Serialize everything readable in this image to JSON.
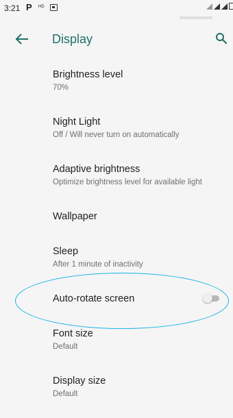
{
  "status_bar": {
    "time": "3:21",
    "icons": [
      "parking-notification-icon",
      "hd-icon",
      "sd-card-icon",
      "signal-icon",
      "signal-icon",
      "battery-icon"
    ],
    "p_glyph": "P",
    "hd_glyph": "HD"
  },
  "app_bar": {
    "title": "Display",
    "back_icon": "back-arrow-icon",
    "search_icon": "search-icon"
  },
  "settings": [
    {
      "label": "Brightness level",
      "summary": "70%"
    },
    {
      "label": "Night Light",
      "summary": "Off / Will never turn on automatically"
    },
    {
      "label": "Adaptive brightness",
      "summary": "Optimize brightness level for available light"
    },
    {
      "label": "Wallpaper",
      "summary": ""
    },
    {
      "label": "Sleep",
      "summary": "After 1 minute of inactivity"
    },
    {
      "label": "Auto-rotate screen",
      "summary": "",
      "toggle": "off"
    },
    {
      "label": "Font size",
      "summary": "Default"
    },
    {
      "label": "Display size",
      "summary": "Default"
    }
  ],
  "colors": {
    "accent": "#1e6f6a",
    "background": "#f5f5f5",
    "annotation": "#16b3e8"
  }
}
